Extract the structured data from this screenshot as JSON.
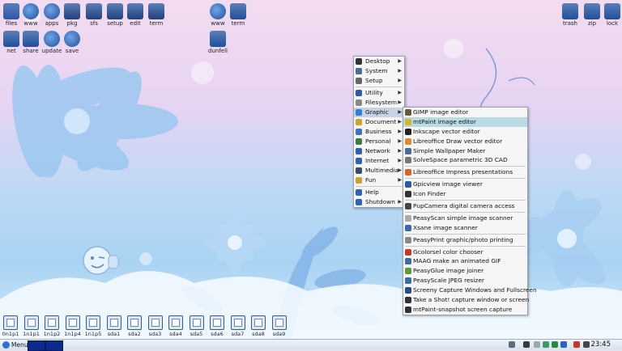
{
  "desktop_top_left": [
    {
      "name": "files-icon",
      "label": "files",
      "color": "#2d56a8"
    },
    {
      "name": "www-icon",
      "label": "www",
      "color": "#1f4f9e"
    },
    {
      "name": "apps-icon",
      "label": "apps",
      "color": "#1f4f9e"
    },
    {
      "name": "pkg-icon",
      "label": "pkg",
      "color": "#1f3f7e"
    },
    {
      "name": "sfs-icon",
      "label": "sfs",
      "color": "#1f3f7e"
    },
    {
      "name": "setup-icon",
      "label": "setup",
      "color": "#1f3f7e"
    },
    {
      "name": "edit-icon",
      "label": "edit",
      "color": "#1f3f7e"
    },
    {
      "name": "term-icon",
      "label": "term",
      "color": "#1f3f7e"
    }
  ],
  "desktop_second_row": [
    {
      "name": "net-icon",
      "label": "net"
    },
    {
      "name": "share-icon",
      "label": "share"
    },
    {
      "name": "update-icon",
      "label": "update"
    },
    {
      "name": "save-icon",
      "label": "save"
    }
  ],
  "desktop_mid": [
    {
      "name": "www2-icon",
      "label": "www"
    },
    {
      "name": "term2-icon",
      "label": "term"
    },
    {
      "name": "dunfell-icon",
      "label": "dunfell"
    }
  ],
  "desktop_top_right": [
    {
      "name": "trash-icon",
      "label": "trash"
    },
    {
      "name": "zip-icon",
      "label": "zip"
    },
    {
      "name": "lock-icon",
      "label": "lock"
    }
  ],
  "main_menu": [
    {
      "label": "Desktop",
      "arrow": true,
      "icon": "#333333"
    },
    {
      "label": "System",
      "arrow": true,
      "icon": "#4a6a9a"
    },
    {
      "label": "Setup",
      "arrow": true,
      "icon": "#666666"
    },
    {
      "sep": true
    },
    {
      "label": "Utility",
      "arrow": true,
      "icon": "#2b5ab0"
    },
    {
      "label": "Filesystem",
      "arrow": true,
      "icon": "#888888"
    },
    {
      "label": "Graphic",
      "arrow": true,
      "icon": "#2e7fd1",
      "selected": true
    },
    {
      "label": "Document",
      "arrow": true,
      "icon": "#cfa42b"
    },
    {
      "label": "Business",
      "arrow": true,
      "icon": "#3a73c8"
    },
    {
      "label": "Personal",
      "arrow": true,
      "icon": "#3b7a3b"
    },
    {
      "label": "Network",
      "arrow": true,
      "icon": "#2a63b8"
    },
    {
      "label": "Internet",
      "arrow": true,
      "icon": "#2a63b8"
    },
    {
      "label": "Multimedia",
      "arrow": true,
      "icon": "#3a4a6a"
    },
    {
      "label": "Fun",
      "arrow": true,
      "icon": "#c9a22b"
    },
    {
      "sep": true
    },
    {
      "label": "Help",
      "arrow": false,
      "icon": "#2a63b8"
    },
    {
      "label": "Shutdown",
      "arrow": true,
      "icon": "#2a63b8"
    }
  ],
  "graphic_submenu": [
    {
      "label": "GIMP image editor",
      "icon": "#6b5a3a"
    },
    {
      "label": "mtPaint image editor",
      "icon": "#d7b52b",
      "selected": true
    },
    {
      "label": "Inkscape vector editor",
      "icon": "#222222"
    },
    {
      "label": "Libreoffice Draw vector editor",
      "icon": "#e08a2b"
    },
    {
      "label": "Simple Wallpaper Maker",
      "icon": "#4a6a9a"
    },
    {
      "label": "SolveSpace parametric 3D CAD",
      "icon": "#777777"
    },
    {
      "sep": true
    },
    {
      "label": "Libreoffice Impress presentations",
      "icon": "#d9622b"
    },
    {
      "sep": true
    },
    {
      "label": "Gpicview image viewer",
      "icon": "#2a5aa0"
    },
    {
      "label": "Icon Finder",
      "icon": "#333333"
    },
    {
      "sep": true
    },
    {
      "label": "PupCamera digital camera access",
      "icon": "#444444"
    },
    {
      "sep": true
    },
    {
      "label": "PeasyScan simple image scanner",
      "icon": "#aaaaaa"
    },
    {
      "label": "Xsane image scanner",
      "icon": "#3a6aa8"
    },
    {
      "sep": true
    },
    {
      "label": "PeasyPrint graphic/photo printing",
      "icon": "#888888"
    },
    {
      "sep": true
    },
    {
      "label": "Gcolorsel color chooser",
      "icon": "#c0392b"
    },
    {
      "label": "MAAG make an animated GIF",
      "icon": "#3a6aa8"
    },
    {
      "label": "PeasyGlue image joiner",
      "icon": "#5a9a3a"
    },
    {
      "label": "PeasyScale JPEG resizer",
      "icon": "#3a6aa8"
    },
    {
      "label": "Screeny Capture Windows and Fullscreen",
      "icon": "#2a4a8a"
    },
    {
      "label": "Take a Shot! capture window or screen",
      "icon": "#333333"
    },
    {
      "label": "mtPaint-snapshot screen capture",
      "icon": "#333333"
    }
  ],
  "drives": [
    "0n1p1",
    "1n1p1",
    "1n1p2",
    "1n1p4",
    "1n1p5",
    "sda1",
    "sda2",
    "sda3",
    "sda4",
    "sda5",
    "sda6",
    "sda7",
    "sda8",
    "sda9"
  ],
  "taskbar": {
    "menu_label": "Menu",
    "clock": "23:45"
  }
}
